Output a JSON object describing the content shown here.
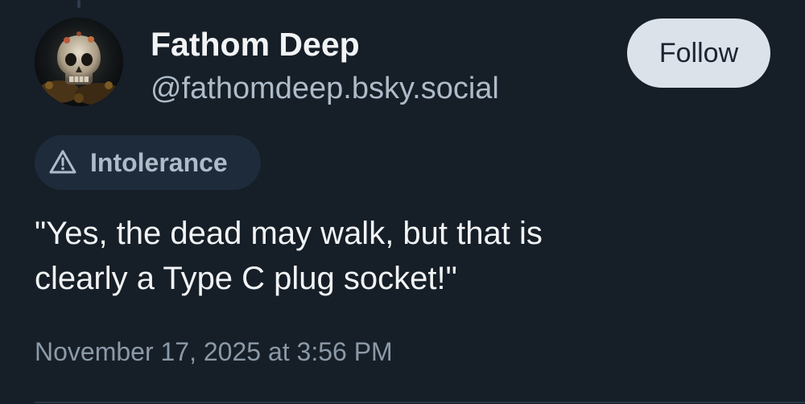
{
  "author": {
    "display_name": "Fathom Deep",
    "handle": "@fathomdeep.bsky.social",
    "avatar_icon": "skull-avatar"
  },
  "follow_button": {
    "label": "Follow"
  },
  "content_label": {
    "icon": "warning-triangle-icon",
    "text": "Intolerance"
  },
  "post": {
    "text": "\"Yes, the dead may walk, but that is\nclearly a Type C plug socket!\"",
    "timestamp": "November 17, 2025 at 3:56 PM"
  },
  "colors": {
    "background": "#161e27",
    "primary_text": "#f1f3f5",
    "secondary_text": "#aebbc9",
    "muted_text": "#8b99a8",
    "button_bg": "#dce2ea",
    "pill_bg": "#1e2b3a"
  }
}
